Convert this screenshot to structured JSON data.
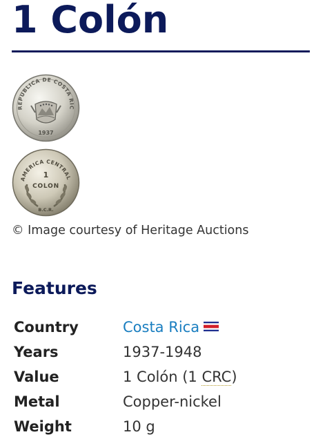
{
  "page": {
    "title": "1 Colón",
    "image_credit": "© Image courtesy of Heritage Auctions"
  },
  "coin_images": {
    "obverse": {
      "legend": "REPUBLICA DE COSTA RICA",
      "year": "1937"
    },
    "reverse": {
      "denomination_number": "1",
      "denomination_word": "COLON",
      "legend": "AMERICA CENTRAL",
      "mint_mark": "B.C.R."
    }
  },
  "features": {
    "heading": "Features",
    "country": {
      "label": "Country",
      "value": "Costa Rica",
      "flag_icon": "costa-rica-flag-icon"
    },
    "years": {
      "label": "Years",
      "value": "1937-1948"
    },
    "value": {
      "label": "Value",
      "prefix": "1 Colón (1 ",
      "abbr": "CRC",
      "suffix": ")"
    },
    "metal": {
      "label": "Metal",
      "value": "Copper-nickel"
    },
    "weight": {
      "label": "Weight",
      "value": "10 g"
    }
  },
  "colors": {
    "heading": "#0c1a5a",
    "link": "#1a7ec0",
    "flag_blue": "#1e2f8f",
    "flag_red": "#d21f2a"
  }
}
